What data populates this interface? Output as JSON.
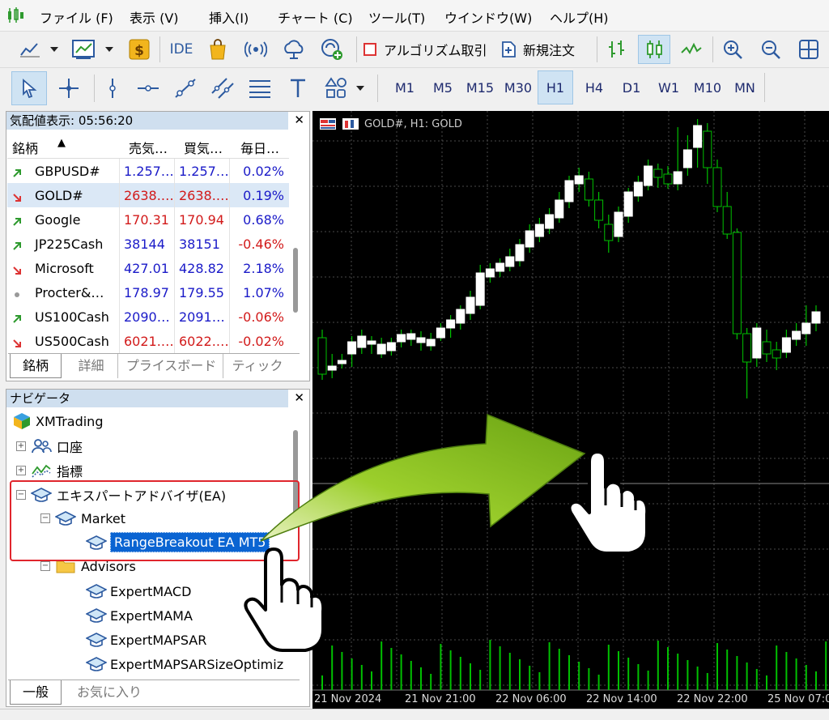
{
  "menu": [
    "ファイル (F)",
    "表示 (V)",
    "挿入(I)",
    "チャート (C)",
    "ツール(T)",
    "ウインドウ(W)",
    "ヘルプ(H)"
  ],
  "toolbar": {
    "ide_label": "IDE",
    "algo_label": "アルゴリズム取引",
    "new_order_label": "新規注文"
  },
  "timeframes": [
    "M1",
    "M5",
    "M15",
    "M30",
    "H1",
    "H4",
    "D1",
    "W1",
    "M10",
    "MN"
  ],
  "timeframe_selected": "H1",
  "market_watch": {
    "title": "気配値表示: 05:56:20",
    "headers": [
      "銘柄",
      "売気…",
      "買気…",
      "毎日…"
    ],
    "rows": [
      {
        "symbol": "GBPUSD#",
        "bid": "1.257…",
        "ask": "1.257…",
        "change": "0.02%",
        "dir": "up",
        "color": "#1a1ac8"
      },
      {
        "symbol": "GOLD#",
        "bid": "2638.…",
        "ask": "2638.…",
        "change": "0.19%",
        "dir": "down",
        "color": "#d21a1a"
      },
      {
        "symbol": "Google",
        "bid": "170.31",
        "ask": "170.94",
        "change": "0.68%",
        "dir": "up",
        "color": "#d21a1a"
      },
      {
        "symbol": "JP225Cash",
        "bid": "38144",
        "ask": "38151",
        "change": "-0.46%",
        "dir": "up",
        "color": "#1a1ac8"
      },
      {
        "symbol": "Microsoft",
        "bid": "427.01",
        "ask": "428.82",
        "change": "2.18%",
        "dir": "down",
        "color": "#1a1ac8"
      },
      {
        "symbol": "Procter&…",
        "bid": "178.97",
        "ask": "179.55",
        "change": "1.07%",
        "dir": "none",
        "color": "#1a1ac8"
      },
      {
        "symbol": "US100Cash",
        "bid": "2090…",
        "ask": "2091…",
        "change": "-0.06%",
        "dir": "up",
        "color": "#1a1ac8"
      },
      {
        "symbol": "US500Cash",
        "bid": "6021.…",
        "ask": "6022.…",
        "change": "-0.02%",
        "dir": "down",
        "color": "#d21a1a"
      }
    ],
    "tabs": [
      "銘柄",
      "詳細",
      "プライスボード",
      "ティック"
    ]
  },
  "navigator": {
    "title": "ナビゲータ",
    "root": "XMTrading",
    "accounts": "口座",
    "indicators": "指標",
    "ea": "エキスパートアドバイザ(EA)",
    "market": "Market",
    "selected_item": "RangeBreakout EA MT5",
    "advisors": "Advisors",
    "advisor_items": [
      "ExpertMACD",
      "ExpertMAMA",
      "ExpertMAPSAR",
      "ExpertMAPSARSizeOptimiz"
    ],
    "tabs": [
      "一般",
      "お気に入り"
    ]
  },
  "chart": {
    "title": "GOLD#, H1:  GOLD",
    "time_labels": [
      "21 Nov 2024",
      "21 Nov 21:00",
      "22 Nov 06:00",
      "22 Nov 14:00",
      "22 Nov 22:00",
      "25 Nov 07:0"
    ]
  },
  "colors": {
    "bull": "#ffffff",
    "bear": "#00c000",
    "highlight": "#0a64d2",
    "callout": "#e0262d"
  }
}
